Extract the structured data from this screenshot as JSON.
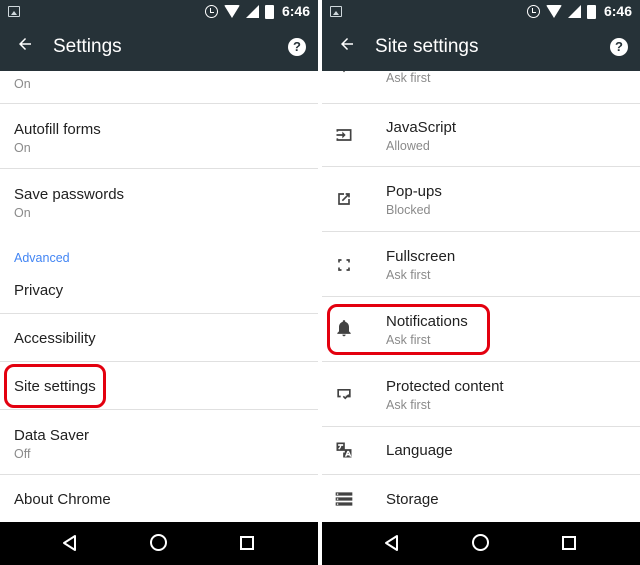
{
  "left": {
    "statusbar": {
      "time": "6:46"
    },
    "toolbar": {
      "title": "Settings",
      "back_icon": "arrow-back-icon",
      "help_icon": "help-icon"
    },
    "items": [
      {
        "title": "",
        "sub": "On"
      },
      {
        "title": "Autofill forms",
        "sub": "On"
      },
      {
        "title": "Save passwords",
        "sub": "On"
      },
      {
        "title": "Privacy"
      },
      {
        "title": "Accessibility"
      },
      {
        "title": "Site settings"
      },
      {
        "title": "Data Saver",
        "sub": "Off"
      },
      {
        "title": "About Chrome"
      }
    ],
    "section_header": "Advanced"
  },
  "right": {
    "statusbar": {
      "time": "6:46"
    },
    "toolbar": {
      "title": "Site settings",
      "back_icon": "arrow-back-icon",
      "help_icon": "help-icon"
    },
    "items": [
      {
        "title": "",
        "sub": "Ask first",
        "icon": "location-icon"
      },
      {
        "title": "JavaScript",
        "sub": "Allowed",
        "icon": "javascript-icon"
      },
      {
        "title": "Pop-ups",
        "sub": "Blocked",
        "icon": "popup-icon"
      },
      {
        "title": "Fullscreen",
        "sub": "Ask first",
        "icon": "fullscreen-icon"
      },
      {
        "title": "Notifications",
        "sub": "Ask first",
        "icon": "bell-icon"
      },
      {
        "title": "Protected content",
        "sub": "Ask first",
        "icon": "protected-content-icon"
      },
      {
        "title": "Language",
        "icon": "translate-icon"
      },
      {
        "title": "Storage",
        "icon": "storage-icon"
      }
    ]
  },
  "colors": {
    "toolbar": "#263238",
    "accent": "#4285f4",
    "highlight": "#e3000f",
    "navbar": "#000000"
  }
}
